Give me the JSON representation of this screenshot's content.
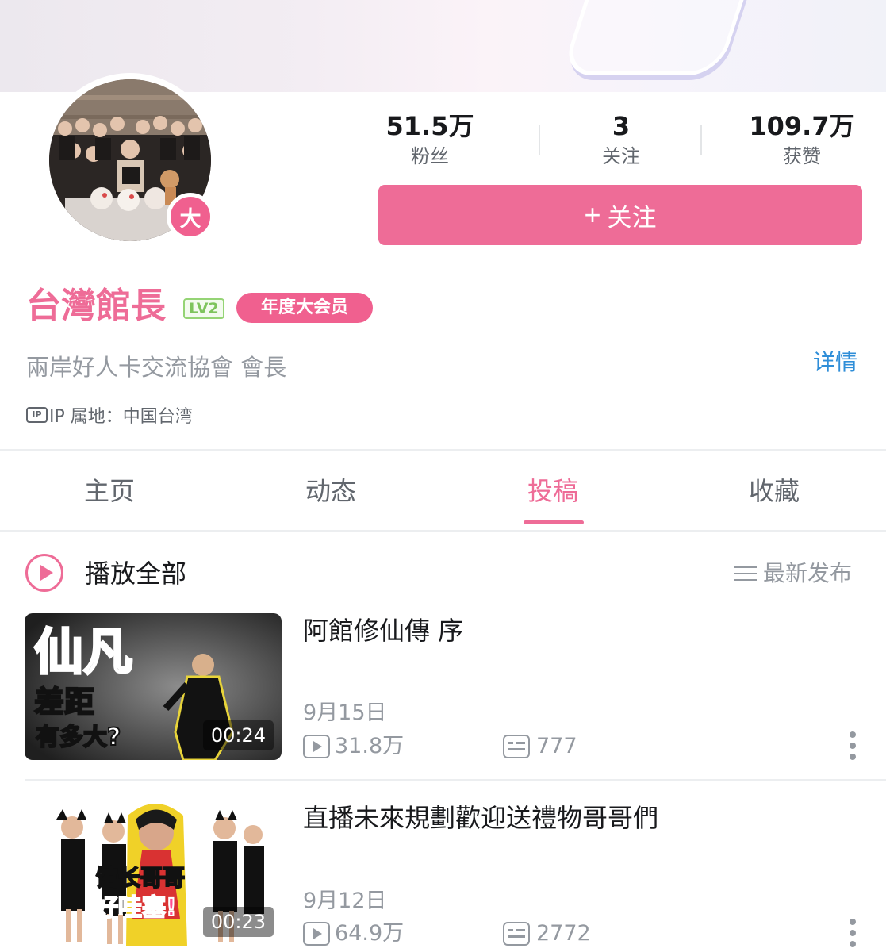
{
  "stats": [
    {
      "value": "51.5万",
      "label": "粉丝"
    },
    {
      "value": "3",
      "label": "关注"
    },
    {
      "value": "109.7万",
      "label": "获赞"
    }
  ],
  "follow_button": {
    "icon": "plus-icon",
    "label": "关注",
    "color": "#ee6c97"
  },
  "avatar": {
    "badge": "大"
  },
  "profile": {
    "name": "台灣館長",
    "level": "LV2",
    "vip_tag": "年度大会员",
    "sign": "兩岸好人卡交流協會 會長",
    "detail_link": "详情",
    "ip_label": "IP 属地：中国台湾",
    "ip_icon": "IP"
  },
  "tabs": [
    {
      "label": "主页",
      "active": false
    },
    {
      "label": "动态",
      "active": false
    },
    {
      "label": "投稿",
      "active": true
    },
    {
      "label": "收藏",
      "active": false
    }
  ],
  "toolbar": {
    "play_all": "播放全部",
    "sort": "最新发布"
  },
  "videos": [
    {
      "title": "阿館修仙傳 序",
      "date": "9月15日",
      "views": "31.8万",
      "danmaku": "777",
      "duration": "00:24",
      "thumb_text": [
        "仙凡",
        "差距",
        "有多大?"
      ]
    },
    {
      "title": "直播未來規劃歡迎送禮物哥哥們",
      "date": "9月12日",
      "views": "64.9万",
      "danmaku": "2772",
      "duration": "00:23",
      "thumb_text": [
        "馆长哥哥",
        "好哇塞!"
      ]
    }
  ],
  "colors": {
    "accent": "#ee6c97",
    "link": "#2f8ed8",
    "muted": "#9499a0"
  }
}
